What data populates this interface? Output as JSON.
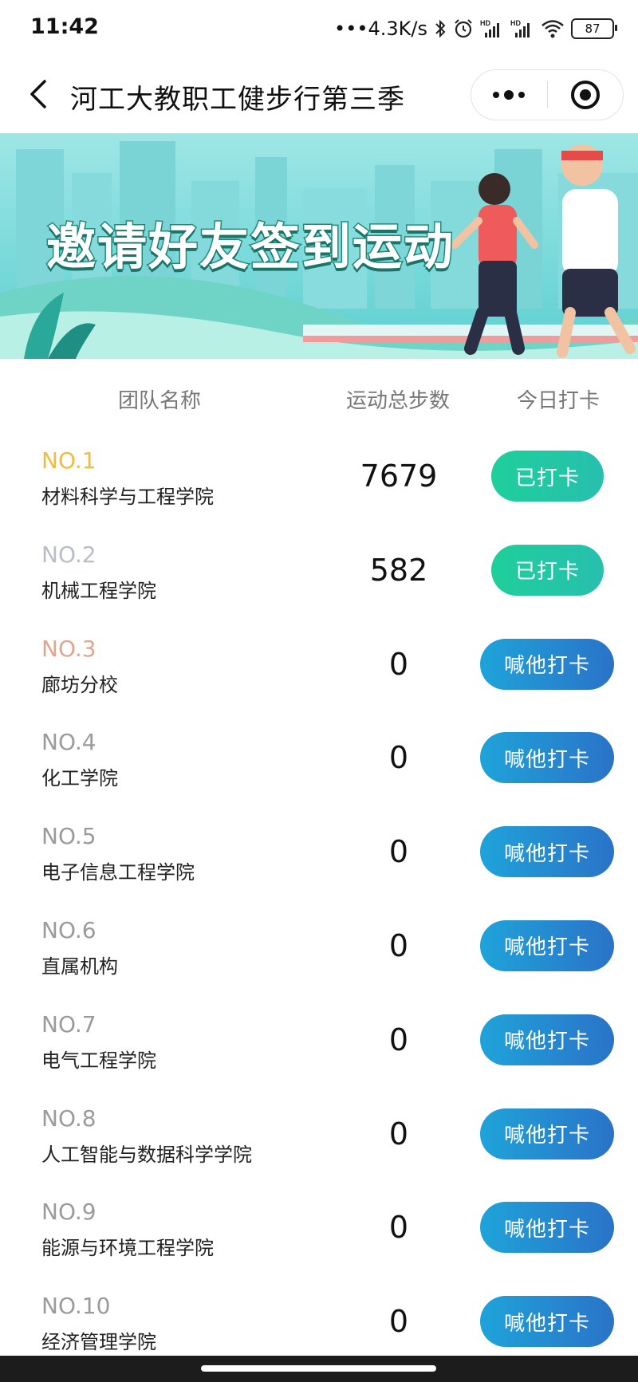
{
  "status_bar": {
    "time": "11:42",
    "network_speed": "•••4.3K/s",
    "signal_label": "HD",
    "battery": "87",
    "icons": [
      "bluetooth-icon",
      "alarm-icon",
      "signal-icon",
      "signal-icon",
      "wifi-icon",
      "battery-icon"
    ]
  },
  "header": {
    "title": "河工大教职工健步行第三季",
    "icons": [
      "back-arrow-icon",
      "more-icon",
      "target-icon"
    ]
  },
  "banner": {
    "title": "邀请好友签到运动"
  },
  "table": {
    "columns": [
      "团队名称",
      "运动总步数",
      "今日打卡"
    ],
    "rows": [
      {
        "rank": "NO.1",
        "team": "材料科学与工程学院",
        "steps": "7679",
        "action": "已打卡",
        "status": "done"
      },
      {
        "rank": "NO.2",
        "team": "机械工程学院",
        "steps": "582",
        "action": "已打卡",
        "status": "done"
      },
      {
        "rank": "NO.3",
        "team": "廊坊分校",
        "steps": "0",
        "action": "喊他打卡",
        "status": "remind"
      },
      {
        "rank": "NO.4",
        "team": "化工学院",
        "steps": "0",
        "action": "喊他打卡",
        "status": "remind"
      },
      {
        "rank": "NO.5",
        "team": "电子信息工程学院",
        "steps": "0",
        "action": "喊他打卡",
        "status": "remind"
      },
      {
        "rank": "NO.6",
        "team": "直属机构",
        "steps": "0",
        "action": "喊他打卡",
        "status": "remind"
      },
      {
        "rank": "NO.7",
        "team": "电气工程学院",
        "steps": "0",
        "action": "喊他打卡",
        "status": "remind"
      },
      {
        "rank": "NO.8",
        "team": "人工智能与数据科学学院",
        "steps": "0",
        "action": "喊他打卡",
        "status": "remind"
      },
      {
        "rank": "NO.9",
        "team": "能源与环境工程学院",
        "steps": "0",
        "action": "喊他打卡",
        "status": "remind"
      },
      {
        "rank": "NO.10",
        "team": "经济管理学院",
        "steps": "0",
        "action": "喊他打卡",
        "status": "remind"
      }
    ]
  },
  "colors": {
    "rank_gold": "#f2bb3d",
    "rank_silver": "#b9bec6",
    "rank_bronze": "#e2a58d",
    "rank_default": "#9b9b9b",
    "done_button": "#20c9a3",
    "remind_button": "#2390d3"
  }
}
